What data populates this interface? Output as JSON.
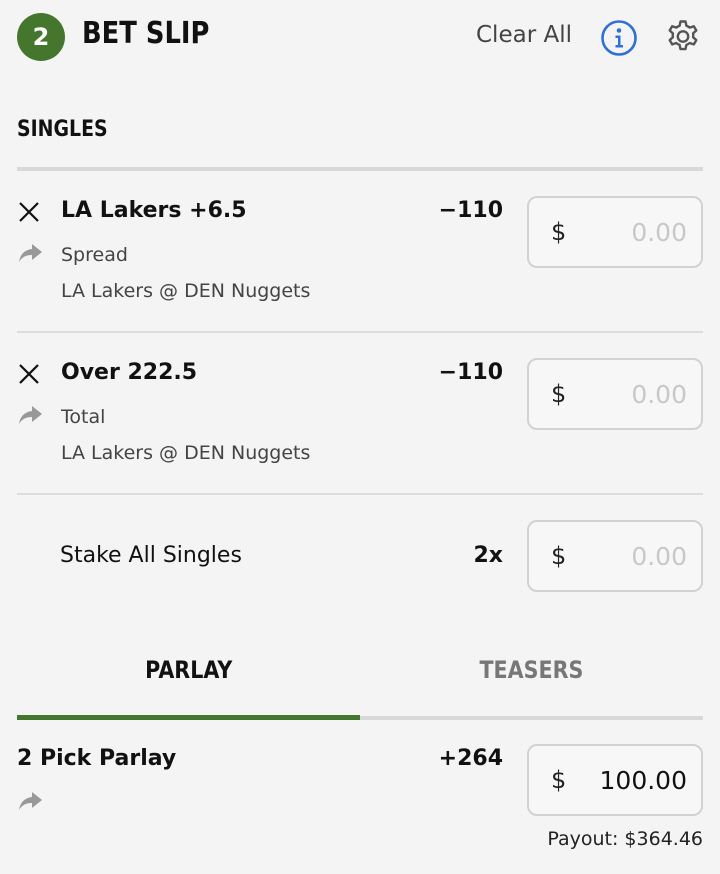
{
  "header": {
    "bet_count": "2",
    "title": "BET SLIP",
    "clear_all_label": "Clear All",
    "accent_color": "#45762e",
    "info_icon": "info-icon",
    "settings_icon": "gear-icon"
  },
  "singles": {
    "section_title": "SINGLES",
    "bets": [
      {
        "selection": "LA Lakers +6.5",
        "odds": "−110",
        "market": "Spread",
        "event": "LA Lakers @ DEN Nuggets",
        "currency": "$",
        "stake_placeholder": "0.00"
      },
      {
        "selection": "Over 222.5",
        "odds": "−110",
        "market": "Total",
        "event": "LA Lakers @ DEN Nuggets",
        "currency": "$",
        "stake_placeholder": "0.00"
      }
    ],
    "stake_all": {
      "label": "Stake All Singles",
      "multiplier": "2x",
      "currency": "$",
      "stake_placeholder": "0.00"
    }
  },
  "tabs": [
    {
      "label": "PARLAY",
      "active": true
    },
    {
      "label": "TEASERS",
      "active": false
    }
  ],
  "parlay": {
    "name": "2 Pick Parlay",
    "odds": "+264",
    "currency": "$",
    "stake": "100.00",
    "payout": "Payout: $364.46"
  }
}
